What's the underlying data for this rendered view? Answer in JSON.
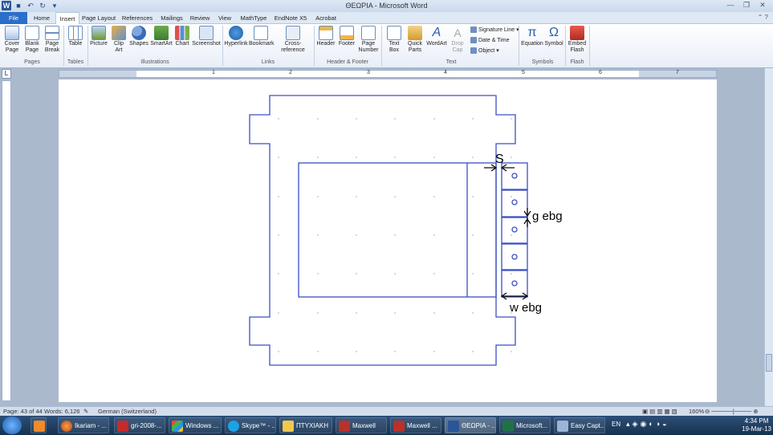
{
  "window": {
    "title": "ΘΕΩΡΙΑ - Microsoft Word"
  },
  "tabs": [
    "File",
    "Home",
    "Insert",
    "Page Layout",
    "References",
    "Mailings",
    "Review",
    "View",
    "MathType",
    "EndNote X5",
    "Acrobat"
  ],
  "ribbon": {
    "pages": {
      "cover": "Cover\nPage",
      "blank": "Blank\nPage",
      "break": "Page\nBreak",
      "label": "Pages"
    },
    "tables": {
      "table": "Table",
      "label": "Tables"
    },
    "illustrations": {
      "picture": "Picture",
      "clipart": "Clip\nArt",
      "shapes": "Shapes",
      "smartart": "SmartArt",
      "chart": "Chart",
      "screenshot": "Screenshot",
      "label": "Illustrations"
    },
    "links": {
      "hyperlink": "Hyperlink",
      "bookmark": "Bookmark",
      "cross": "Cross-reference",
      "label": "Links"
    },
    "headerfooter": {
      "header": "Header",
      "footer": "Footer",
      "pagenumber": "Page\nNumber",
      "label": "Header & Footer"
    },
    "text": {
      "textbox": "Text\nBox",
      "quickparts": "Quick\nParts",
      "wordart": "WordArt",
      "dropcap": "Drop\nCap",
      "signature": "Signature Line",
      "datetime": "Date & Time",
      "object": "Object",
      "label": "Text"
    },
    "symbols": {
      "equation": "Equation",
      "symbol": "Symbol",
      "label": "Symbols"
    },
    "flash": {
      "embed": "Embed\nFlash",
      "label": "Flash"
    }
  },
  "ruler": {
    "labels": [
      "1",
      "2",
      "3",
      "4",
      "5",
      "6",
      "7"
    ]
  },
  "diagram": {
    "label_s": "S",
    "label_g": "g ebg",
    "label_w": "w ebg"
  },
  "status": {
    "page": "Page: 43 of 44",
    "words": "Words: 6,126",
    "language": "German (Switzerland)",
    "zoom": "160%"
  },
  "taskbar": {
    "items": [
      "Ikariam - ...",
      "gri-2008-...",
      "Windows ...",
      "Skype™ - ...",
      "ΠΤΥΧΙΑΚΗ",
      "Maxwell",
      "Maxwell ...",
      "ΘΕΩΡΙΑ - ...",
      "Microsoft...",
      "Easy Capt..."
    ],
    "lang": "EN",
    "time": "4:34 PM",
    "date": "19-Mar-13"
  },
  "colors": {
    "diagram_blue": "#3b4fc4",
    "file_tab": "#2a6fc9",
    "taskbar": "#17324f"
  }
}
